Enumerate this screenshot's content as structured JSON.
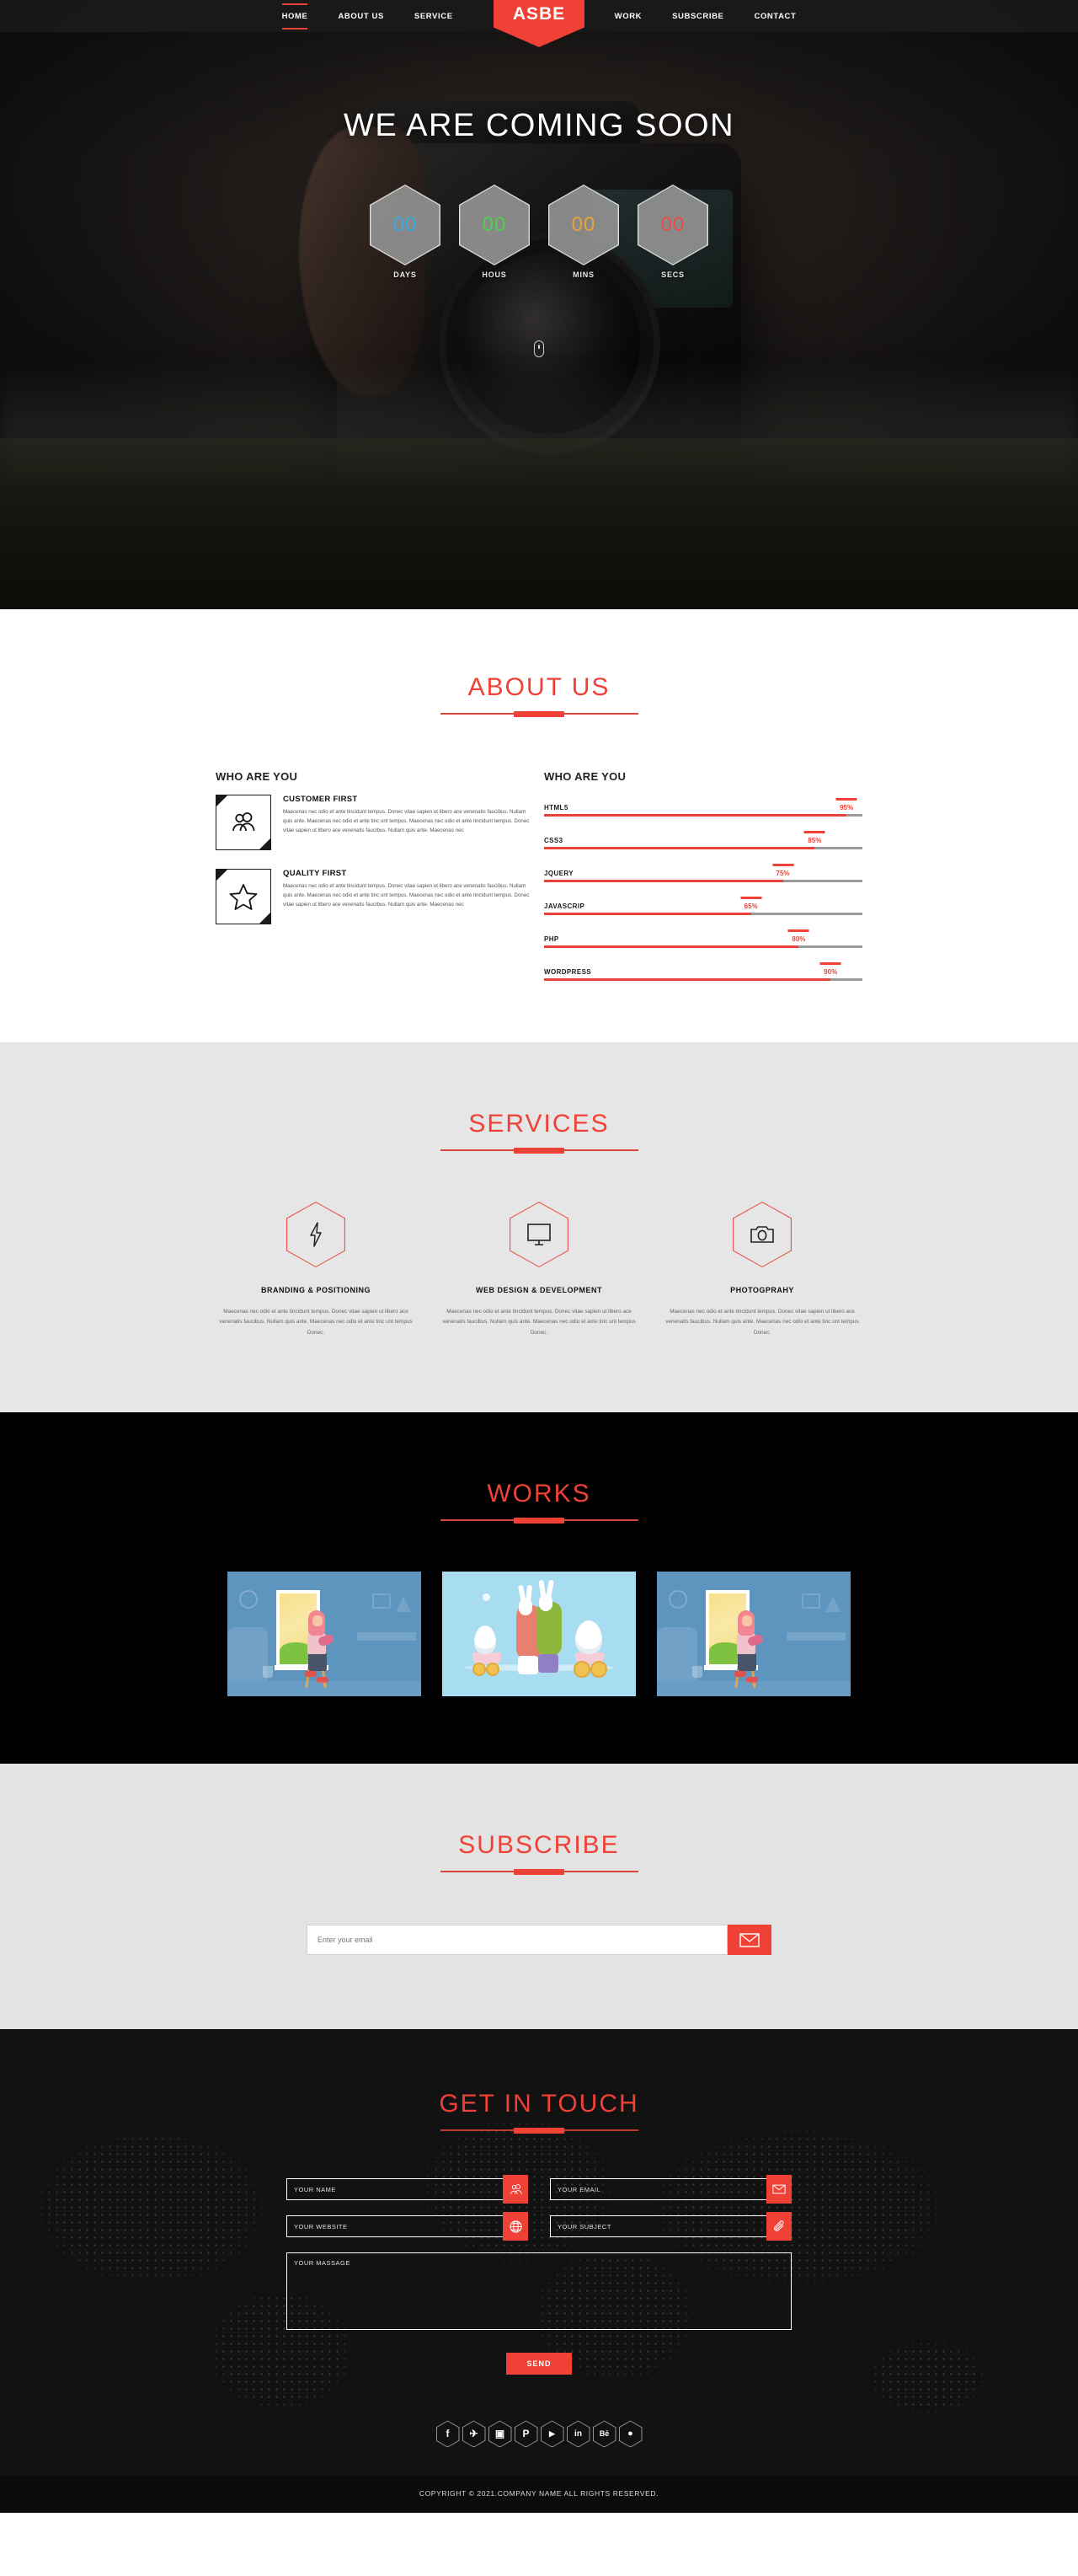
{
  "nav": {
    "brand": "ASBE",
    "left_items": [
      {
        "label": "HOME",
        "active": true
      },
      {
        "label": "ABOUT US",
        "active": false
      },
      {
        "label": "SERVICE",
        "active": false
      }
    ],
    "right_items": [
      {
        "label": "WORK",
        "active": false
      },
      {
        "label": "SUBSCRIBE",
        "active": false
      },
      {
        "label": "CONTACT",
        "active": false
      }
    ]
  },
  "hero": {
    "title": "WE ARE COMING SOON",
    "countdown": [
      {
        "value": "00",
        "label": "DAYS",
        "color": "#3aa9dd"
      },
      {
        "value": "00",
        "label": "HOUS",
        "color": "#4ed14e"
      },
      {
        "value": "00",
        "label": "MINS",
        "color": "#e8a33a"
      },
      {
        "value": "00",
        "label": "SECS",
        "color": "#ed4b4b"
      }
    ],
    "scroll_hint_icon": "mouse-scroll-icon"
  },
  "about": {
    "title": "ABOUT US",
    "left_heading": "WHO ARE YOU",
    "features": [
      {
        "icon": "users-icon",
        "title": "CUSTOMER FIRST",
        "text": "Maecenas nec odio et ante tincidunt tempus. Donec vitae sapien ut libero ace venenatis faucibus. Nullam quis ante. Maecenas nec odio et ante tinc unt tempus. Maecenas nec odio et ante tincidunt tempus. Donec vitae sapien ut libero ace venenatis faucibus. Nullam quis ante. Maecenas nec"
      },
      {
        "icon": "star-icon",
        "title": "QUALITY FIRST",
        "text": "Maecenas nec odio et ante tincidunt tempus. Donec vitae sapien ut libero ace venenatis faucibus. Nullam quis ante. Maecenas nec odio et ante tinc unt tempus. Maecenas nec odio et ante tincidunt tempus. Donec vitae sapien ut libero ace venenatis faucibus. Nullam quis ante. Maecenas nec"
      }
    ],
    "right_heading": "WHO ARE YOU",
    "skills": [
      {
        "name": "HTML5",
        "percent": 95,
        "label": "95%"
      },
      {
        "name": "CSS3",
        "percent": 85,
        "label": "85%"
      },
      {
        "name": "JQUERY",
        "percent": 75,
        "label": "75%"
      },
      {
        "name": "JAVASCRIP",
        "percent": 65,
        "label": "65%"
      },
      {
        "name": "PHP",
        "percent": 80,
        "label": "80%"
      },
      {
        "name": "WORDPRESS",
        "percent": 90,
        "label": "90%"
      }
    ]
  },
  "services": {
    "title": "SERVICES",
    "items": [
      {
        "icon": "lightning-bolt-icon",
        "title": "BRANDING & POSITIONING",
        "text": "Maecenas nec odio et ante tincidunt tempus. Donec vitae sapien ut libero ace venenatis faucibus. Nullam quis ante. Maecenas nec odio et ante tinc unt tempus Donec."
      },
      {
        "icon": "monitor-icon",
        "title": "WEB DESIGN & DEVELOPMENT",
        "text": "Maecenas nec odio et ante tincidunt tempus. Donec vitae sapien ut libero ace venenatis faucibus. Nullam quis ante. Maecenas nec odio et ante tinc unt tempus Donec."
      },
      {
        "icon": "camera-icon",
        "title": "PHOTOGPRAHY",
        "text": "Maecenas nec odio et ante tincidunt tempus. Donec vitae sapien ut libero ace venenatis faucibus. Nullam quis ante. Maecenas nec odio et ante tinc unt tempus Donec."
      }
    ]
  },
  "works": {
    "title": "WORKS",
    "items": [
      {
        "alt": "illustration-girl-playing-guitar-by-window"
      },
      {
        "alt": "illustration-two-rabbits-pulling-egg-carts"
      },
      {
        "alt": "illustration-girl-playing-guitar-by-window"
      }
    ]
  },
  "subscribe": {
    "title": "SUBSCRIBE",
    "placeholder": "Enter your email",
    "value": "",
    "button_icon": "envelope-icon"
  },
  "contact": {
    "title": "GET IN TOUCH",
    "fields": [
      {
        "placeholder": "YOUR NAME",
        "icon": "users-icon"
      },
      {
        "placeholder": "YOUR EMAIL",
        "icon": "envelope-icon"
      },
      {
        "placeholder": "YOUR WEBSITE",
        "icon": "globe-icon"
      },
      {
        "placeholder": "YOUR SUBJECT",
        "icon": "paperclip-icon"
      }
    ],
    "message_placeholder": "YOUR MASSAGE",
    "send_label": "SEND"
  },
  "footer": {
    "socials": [
      {
        "name": "facebook-icon",
        "glyph": "f"
      },
      {
        "name": "twitter-icon",
        "glyph": "✈"
      },
      {
        "name": "instagram-icon",
        "glyph": "▣"
      },
      {
        "name": "pinterest-icon",
        "glyph": "P"
      },
      {
        "name": "youtube-icon",
        "glyph": "▶"
      },
      {
        "name": "linkedin-icon",
        "glyph": "in"
      },
      {
        "name": "behance-icon",
        "glyph": "Bē"
      },
      {
        "name": "dribbble-icon",
        "glyph": "●"
      }
    ],
    "copyright": "COPYRIGHT © 2021.COMPANY NAME ALL RIGHTS RESERVED."
  },
  "colors": {
    "accent": "#ef4136",
    "accent_dark": "#d9463c",
    "dark": "#121212",
    "light_gray": "#e6e6e6"
  }
}
